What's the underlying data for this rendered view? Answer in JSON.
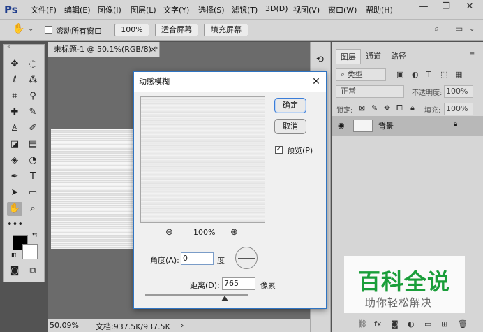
{
  "app": {
    "logo": "Ps"
  },
  "menu": [
    "文件(F)",
    "编辑(E)",
    "图像(I)",
    "图层(L)",
    "文字(Y)",
    "选择(S)",
    "滤镜(T)",
    "3D(D)",
    "视图(V)",
    "窗口(W)",
    "帮助(H)"
  ],
  "window_controls": {
    "minimize": "—",
    "restore": "❐",
    "close": "✕"
  },
  "options": {
    "scroll_all_label": "滚动所有窗口",
    "zoom_value": "100%",
    "fit_screen_label": "适合屏幕",
    "fill_screen_label": "填充屏幕"
  },
  "document": {
    "tab_title": "未标题-1 @ 50.1%(RGB/8) *",
    "tab_close": "×",
    "status_zoom": "50.09%",
    "status_doc": "文档:937.5K/937.5K",
    "status_arrow": "›"
  },
  "dialog": {
    "title": "动感模糊",
    "close": "✕",
    "ok_label": "确定",
    "cancel_label": "取消",
    "preview_label": "预览(P)",
    "preview_checked": true,
    "zoom_value": "100%",
    "angle_label": "角度(A):",
    "angle_value": "0",
    "angle_unit": "度",
    "distance_label": "距离(D):",
    "distance_value": "765",
    "distance_unit": "像素"
  },
  "layers": {
    "tabs": [
      "图层",
      "通道",
      "路径"
    ],
    "kind_filter": "类型",
    "blend_mode": "正常",
    "opacity_label": "不透明度:",
    "opacity_value": "100%",
    "lock_label": "锁定:",
    "fill_label": "填充:",
    "fill_value": "100%",
    "layer_name": "背景"
  },
  "watermark": {
    "title": "百科全说",
    "subtitle": "助你轻松解决"
  },
  "colors": {
    "panel_bg": "#d6d6d6",
    "workspace_bg": "#535353",
    "accent": "#2f74c2",
    "watermark_green": "#1a9e3a"
  }
}
